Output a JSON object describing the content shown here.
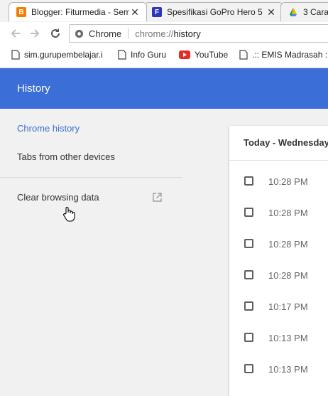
{
  "tabs": [
    {
      "title": "Blogger: Fiturmedia - Sem",
      "favicon": "blogger-icon",
      "color": "#f57d00",
      "glyph": "B"
    },
    {
      "title": "Spesifikasi GoPro Hero 5",
      "favicon": "f-icon",
      "color": "#2d37b8",
      "glyph": "F"
    },
    {
      "title": "3 Cara",
      "favicon": "google-drive-icon",
      "color": "#f4b400",
      "glyph": ""
    }
  ],
  "omnibox": {
    "site_label": "Chrome",
    "url_prefix": "chrome://",
    "url_path": "history"
  },
  "bookmarks": [
    {
      "label": "sim.gurupembelajar.i",
      "icon": "page-icon"
    },
    {
      "label": "Info Guru",
      "icon": "page-icon"
    },
    {
      "label": "YouTube",
      "icon": "youtube-icon"
    },
    {
      "label": ".:: EMIS Madrasah ::.",
      "icon": "page-icon"
    }
  ],
  "header": {
    "title": "History",
    "color": "#3b6ed6"
  },
  "sidebar": {
    "chrome_history": "Chrome history",
    "other_devices": "Tabs from other devices",
    "clear_data": "Clear browsing data"
  },
  "card": {
    "heading": "Today - Wednesday",
    "entries": [
      {
        "time": "10:28 PM"
      },
      {
        "time": "10:28 PM"
      },
      {
        "time": "10:28 PM"
      },
      {
        "time": "10:28 PM"
      },
      {
        "time": "10:17 PM"
      },
      {
        "time": "10:13 PM"
      },
      {
        "time": "10:13 PM"
      }
    ]
  }
}
